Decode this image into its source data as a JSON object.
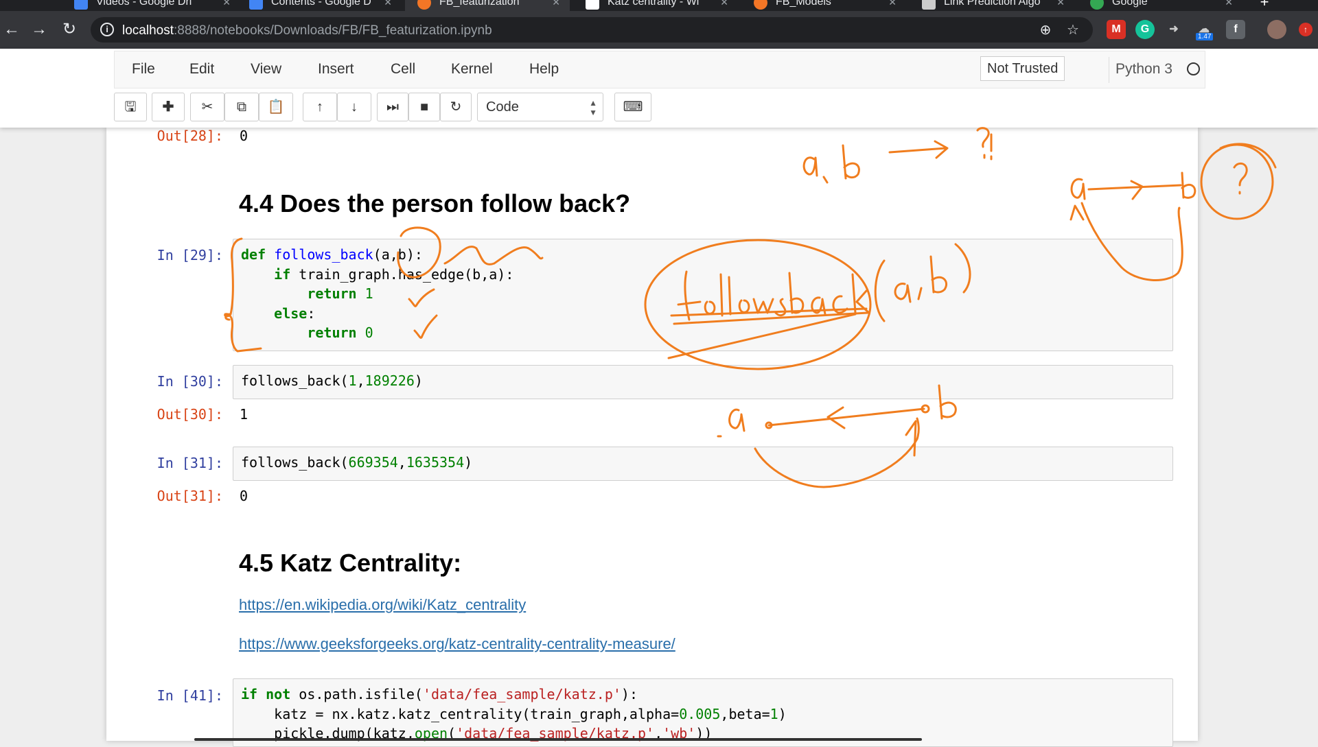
{
  "browser": {
    "tabs": [
      {
        "label": "Videos - Google Dri",
        "fav_color": "#4285f4",
        "active": false
      },
      {
        "label": "Contents - Google D",
        "fav_color": "#4285f4",
        "active": false
      },
      {
        "label": "FB_featurization",
        "fav_color": "#f37626",
        "active": true
      },
      {
        "label": "Katz centrality - Wi",
        "fav_color": "#ffffff",
        "active": false
      },
      {
        "label": "FB_Models",
        "fav_color": "#f37626",
        "active": false
      },
      {
        "label": "Link Prediction Algo",
        "fav_color": "#cccccc",
        "active": false
      },
      {
        "label": "Google",
        "fav_color": "#34a853",
        "active": false
      }
    ],
    "url_host": "localhost",
    "url_path": ":8888/notebooks/Downloads/FB/FB_featurization.ipynb",
    "extension_badge": "1.47"
  },
  "jupyter": {
    "menu": [
      "File",
      "Edit",
      "View",
      "Insert",
      "Cell",
      "Kernel",
      "Help"
    ],
    "trusted": "Not Trusted",
    "kernel": "Python 3",
    "cell_type": "Code"
  },
  "cells": {
    "out28_prompt": "Out[28]:",
    "out28_value": "0",
    "heading_44": "4.4 Does the person follow back?",
    "in29_prompt": "In [29]:",
    "in30_prompt": "In [30]:",
    "out30_prompt": "Out[30]:",
    "out30_value": "1",
    "in31_prompt": "In [31]:",
    "out31_prompt": "Out[31]:",
    "out31_value": "0",
    "heading_45": "4.5 Katz Centrality:",
    "link1": "https://en.wikipedia.org/wiki/Katz_centrality",
    "link2": "https://www.geeksforgeeks.org/katz-centrality-centrality-measure/",
    "in41_prompt": "In [41]:"
  },
  "annotation_color": "#f07d1e"
}
